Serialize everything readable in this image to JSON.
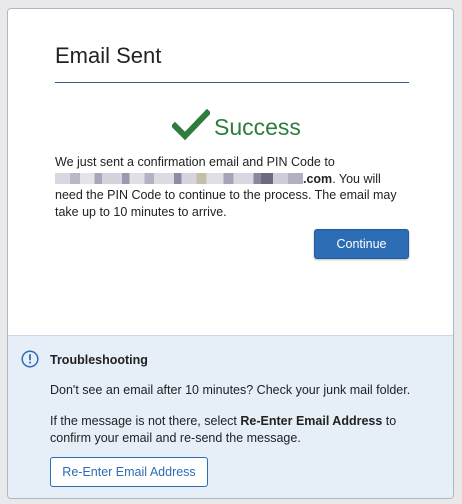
{
  "dialog": {
    "title": "Email Sent",
    "success_label": "Success",
    "message_before": "We just sent a confirmation email and PIN Code to ",
    "email_domain_suffix": ".com",
    "message_after": ". You will need the PIN Code to continue to the process. The email may take up to 10 minutes to arrive.",
    "continue_label": "Continue"
  },
  "troubleshooting": {
    "heading": "Troubleshooting",
    "line1": "Don't see an email after 10 minutes? Check your junk mail folder.",
    "line2_before": "If the message is not there, select ",
    "line2_bold": "Re-Enter Email Address",
    "line2_after": " to confirm your email and re-send the message.",
    "reenter_label": "Re-Enter Email Address"
  },
  "colors": {
    "success_green": "#2e7d3f",
    "primary_blue": "#2d6db5",
    "panel_background": "#e6eef7"
  },
  "icons": {
    "success": "checkmark-icon",
    "info": "info-circle-icon"
  }
}
